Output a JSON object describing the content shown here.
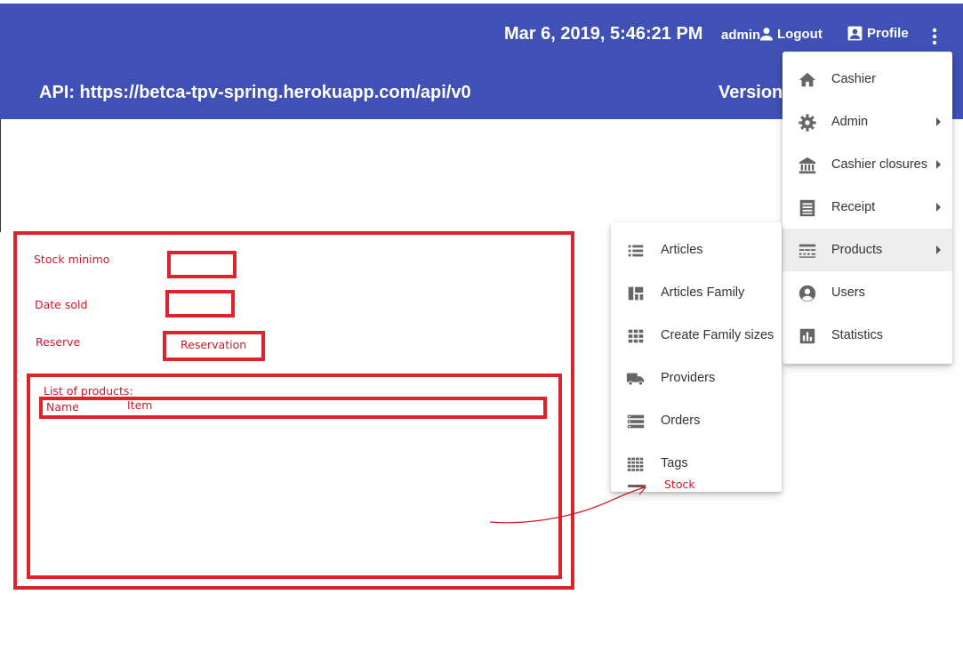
{
  "header": {
    "datetime": "Mar 6, 2019, 5:46:21 PM",
    "user": "admin",
    "logout_label": "Logout",
    "profile_label": "Profile",
    "api_text": "API: https://betca-tpv-spring.herokuapp.com/api/v0",
    "version_text": "Version:",
    "background_color": "#3f51b5"
  },
  "main_menu": {
    "items": [
      {
        "label": "Cashier",
        "icon": "home-icon"
      },
      {
        "label": "Admin",
        "icon": "gear-icon",
        "submenu": true
      },
      {
        "label": "Cashier closures",
        "icon": "bank-icon",
        "submenu": true
      },
      {
        "label": "Receipt",
        "icon": "receipt-icon",
        "submenu": true
      },
      {
        "label": "Products",
        "icon": "products-icon",
        "submenu": true,
        "active": true
      },
      {
        "label": "Users",
        "icon": "account-circle-icon"
      },
      {
        "label": "Statistics",
        "icon": "chart-icon"
      }
    ]
  },
  "products_submenu": {
    "items": [
      {
        "label": "Articles",
        "icon": "list-icon"
      },
      {
        "label": "Articles Family",
        "icon": "dashboard-icon"
      },
      {
        "label": "Create Family sizes",
        "icon": "grid-icon"
      },
      {
        "label": "Providers",
        "icon": "truck-icon"
      },
      {
        "label": "Orders",
        "icon": "storage-icon"
      },
      {
        "label": "Tags",
        "icon": "apps-grid-icon"
      }
    ]
  },
  "mockup": {
    "stock_min_label": "Stock minimo",
    "date_sold_label": "Date sold",
    "reserve_label": "Reserve",
    "reservation_text": "Reservation",
    "list_title": "List of products:",
    "col_name": "Name",
    "col_item": "Item",
    "stock_note": "Stock",
    "annotation_color": "#e0232b"
  }
}
